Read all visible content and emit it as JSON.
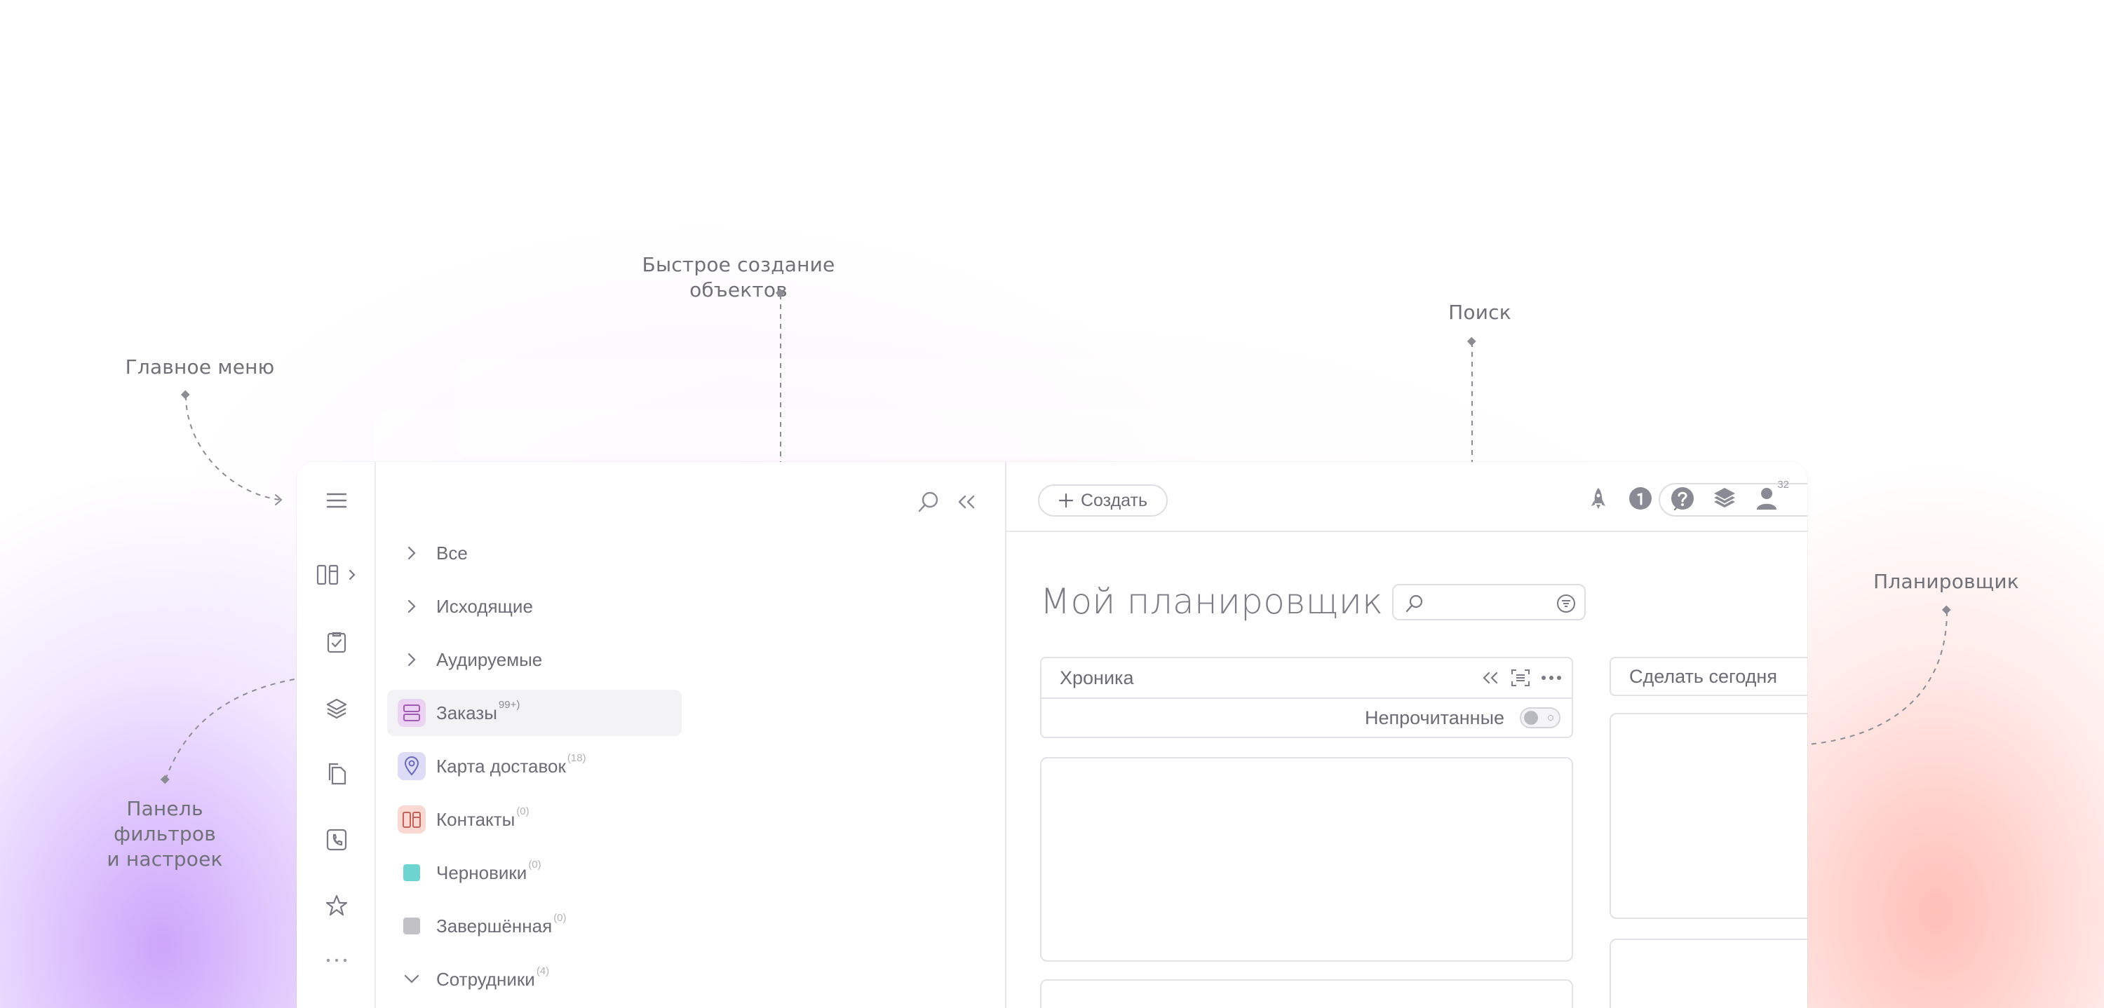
{
  "annotations": {
    "main_menu": "Главное меню",
    "quick_create": "Быстрое создание объектов",
    "search": "Поиск",
    "planner": "Планировщик",
    "filters_panel": [
      "Панель",
      "фильтров",
      "и настроек"
    ]
  },
  "rail": {
    "icons": [
      "menu-icon",
      "boards-icon",
      "chevron-right-icon",
      "task-check-icon",
      "layers-icon",
      "documents-icon",
      "phone-book-icon",
      "star-icon",
      "more-icon"
    ]
  },
  "filters": {
    "items": [
      {
        "label": "Все",
        "lead": "chevron-right-icon"
      },
      {
        "label": "Исходящие",
        "lead": "chevron-right-icon"
      },
      {
        "label": "Аудируемые",
        "lead": "chevron-right-icon"
      },
      {
        "label": "Заказы",
        "count": "99+)",
        "lead": "orders-icon",
        "active": true,
        "chip_color": "#ecd3f3"
      },
      {
        "label": "Карта доставок",
        "count": "(18)",
        "lead": "map-pin-icon",
        "chip_color": "#dcdcf6"
      },
      {
        "label": "Контакты",
        "count": "(0)",
        "lead": "contacts-icon",
        "chip_color": "#fbd9d2"
      },
      {
        "label": "Черновики",
        "count": "(0)",
        "lead": "color-square",
        "square_color": "#6ed4cf"
      },
      {
        "label": "Завершённая",
        "count": "(0)",
        "lead": "color-square",
        "square_color": "#c2c2c6"
      },
      {
        "label": "Сотрудники",
        "count": "(4)",
        "lead": "chevron-down-icon"
      }
    ]
  },
  "topbar": {
    "create_label": "Создать",
    "search_placeholder": "",
    "icons": [
      "rocket-icon",
      "info-icon",
      "help-icon",
      "layers-icon",
      "user-icon"
    ],
    "user_count": "32"
  },
  "main": {
    "title": "Мой планировщик",
    "timeline": {
      "title": "Хроника",
      "unread_label": "Непрочитанные"
    },
    "today": {
      "title": "Сделать сегодня"
    }
  }
}
